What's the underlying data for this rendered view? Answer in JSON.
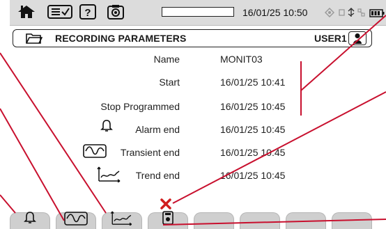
{
  "status_bar": {
    "datetime": "16/01/25 10:50",
    "icons": [
      "home-icon",
      "checklist-icon",
      "help-icon",
      "camera-icon",
      "sync-icon",
      "usb-network-icon",
      "battery-icon"
    ]
  },
  "header": {
    "title": "RECORDING PARAMETERS",
    "user": "USER1",
    "icons": [
      "folder-icon",
      "user-icon"
    ]
  },
  "rows": {
    "name": {
      "label": "Name",
      "value": "MONIT03"
    },
    "start": {
      "label": "Start",
      "value": "16/01/25 10:41"
    },
    "stop": {
      "label": "Stop Programmed",
      "value": "16/01/25 10:45"
    },
    "alarm": {
      "label": "Alarm end",
      "value": "16/01/25 10:45",
      "icon": "bell-icon"
    },
    "transient": {
      "label": "Transient end",
      "value": "16/01/25 10:45",
      "icon": "transient-icon"
    },
    "trend": {
      "label": "Trend end",
      "value": "16/01/25 10:45",
      "icon": "trend-icon"
    }
  },
  "bottom_tabs": [
    "bell-icon",
    "transient-icon",
    "trend-icon",
    "camera-icon",
    "",
    "",
    "",
    "",
    ""
  ],
  "colors": {
    "callout": "#c8102e",
    "delete_mark": "#d01c1c",
    "status_bg": "#dcdcdc",
    "tab_bg": "#cfcfcf"
  }
}
